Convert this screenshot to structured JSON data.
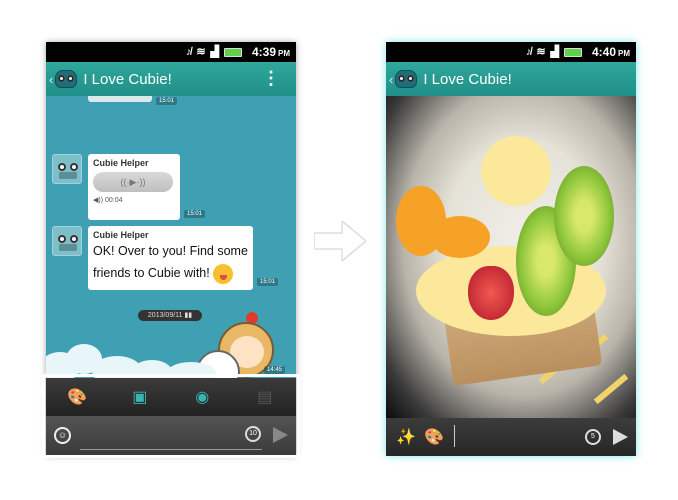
{
  "left": {
    "status": {
      "time": "4:39",
      "ampm": "PM"
    },
    "header": {
      "title": "I Love Cubie!"
    },
    "messages": [
      {
        "sender": "Cubie Helper",
        "type": "voice",
        "duration": "00:04",
        "time": "15:01"
      },
      {
        "sender": "Cubie Helper",
        "type": "text",
        "text": "OK! Over to you! Find some friends to Cubie with!",
        "time": "15:01"
      }
    ],
    "date_separator": "2013/09/11",
    "sticker_time": "14:45",
    "toolbar": [
      "doodle-icon",
      "gallery-icon",
      "camera-icon",
      "video-icon"
    ],
    "input": {
      "placeholder": "",
      "timer": "10"
    }
  },
  "right": {
    "status": {
      "time": "4:40",
      "ampm": "PM"
    },
    "header": {
      "title": "I Love Cubie!"
    },
    "input": {
      "placeholder": "",
      "timer": "5"
    }
  },
  "colors": {
    "header": "#2a9f96",
    "chat_bg": "#3fa0b3",
    "accent": "#3ab3b3"
  }
}
